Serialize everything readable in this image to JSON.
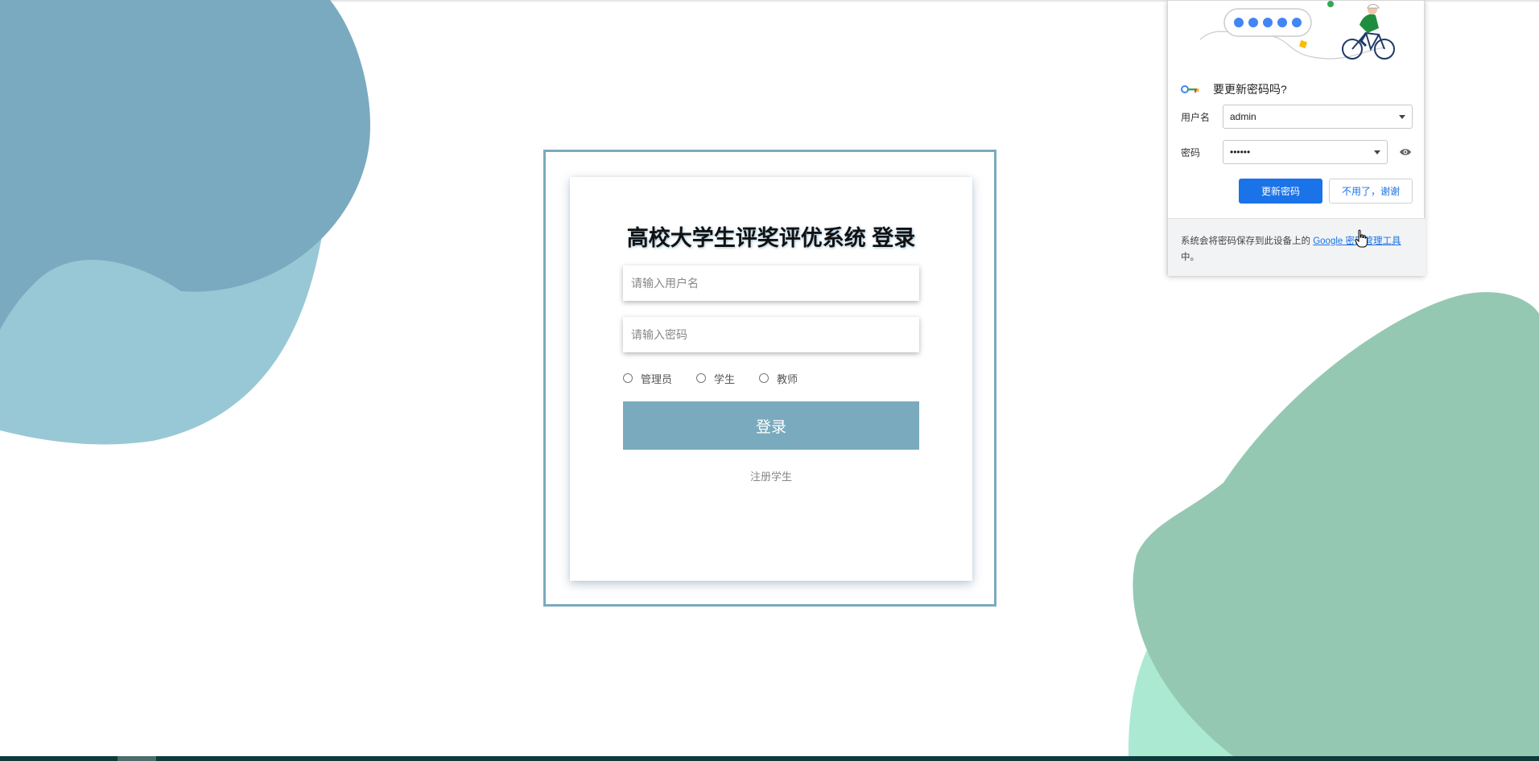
{
  "login": {
    "title": "高校大学生评奖评优系统 登录",
    "username_placeholder": "请输入用户名",
    "password_placeholder": "请输入密码",
    "roles": [
      "管理员",
      "学生",
      "教师"
    ],
    "submit_label": "登录",
    "register_label": "注册学生"
  },
  "password_prompt": {
    "title": "要更新密码吗?",
    "username_label": "用户名",
    "username_value": "admin",
    "password_label": "密码",
    "password_value": "••••••",
    "update_label": "更新密码",
    "decline_label": "不用了，谢谢",
    "footer_text": "系统会将密码保存到此设备上的",
    "footer_link": "Google 密码管理工具",
    "footer_suffix": "中。"
  },
  "colors": {
    "accent": "#7aaabd",
    "blob_blue_dark": "#79aac0",
    "blob_blue_light": "#98c8d5",
    "blob_green_dark": "#95c8b2",
    "blob_green_light": "#abe9d3",
    "chrome_blue": "#1a73e8"
  }
}
